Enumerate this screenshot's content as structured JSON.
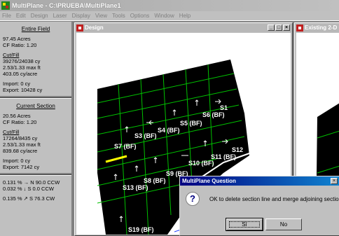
{
  "app": {
    "title": "MultiPlane - C:\\PRUEBA\\MultiPlane1"
  },
  "menu": [
    "File",
    "Edit",
    "Design",
    "Laser",
    "Display",
    "View",
    "Tools",
    "Options",
    "Window",
    "Help"
  ],
  "left_panel": {
    "entire_field_heading": "Entire Field",
    "entire": {
      "acres": "97.45 Acres",
      "cf_ratio": "CF Ratio: 1.20",
      "cutfill_label": "Cut/Fill",
      "cy": "39276/24038 cy",
      "max_ft": "2.53/1.33 max ft",
      "cy_acre": "403.05 cy/acre",
      "import": "Import: 0 cy",
      "export": "Export: 10428 cy"
    },
    "current_section_heading": "Current Section",
    "current": {
      "acres": "20.56 Acres",
      "cf_ratio": "CF Ratio: 1.20",
      "cutfill_label": "Cut/Fill",
      "cy": "17264/8435 cy",
      "max_ft": "2.53/1.33 max ft",
      "cy_acre": "839.68 cy/acre",
      "import": "Import: 0 cy",
      "export": "Export: 7142 cy"
    },
    "slopes": {
      "s1": "0.131 % → N 90.0 CCW",
      "s2": "0.032 % ↓ S 0.0 CCW",
      "s3": "0.135 % ↗ S 76.3 CW"
    }
  },
  "design_window": {
    "title": "Design",
    "section_labels": [
      "S1",
      "S5 (BF)",
      "S6 (BF)",
      "S4 (BF)",
      "S3 (BF)",
      "S7 (BF)",
      "S12",
      "S11 (BF)",
      "S10 (BF)",
      "S9 (BF)",
      "S8 (BF)",
      "S13 (BF)",
      "S19 (BF)"
    ]
  },
  "existing_window": {
    "title": "Existing 2-D"
  },
  "dialog": {
    "title": "MultiPlane Question",
    "message": "OK to delete section line and merge adjoining sections?",
    "yes_label": "Sí",
    "no_label": "No",
    "icon": "question-icon"
  },
  "colors": {
    "field": "#000000",
    "grid": "#00c000",
    "selected_line": "#ffff00",
    "dialog_title": "#000080"
  }
}
